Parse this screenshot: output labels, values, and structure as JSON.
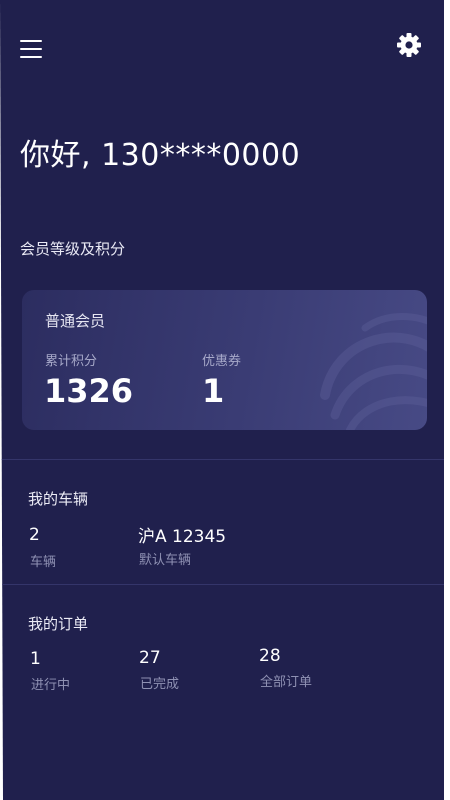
{
  "header": {
    "menu_icon": "hamburger-menu-icon",
    "settings_icon": "gear-icon"
  },
  "greeting": "你好, 130****0000",
  "membership": {
    "section_title": "会员等级及积分",
    "level": "普通会员",
    "points_label": "累计积分",
    "points_value": "1326",
    "coupons_label": "优惠券",
    "coupons_value": "1"
  },
  "vehicles": {
    "title": "我的车辆",
    "count_value": "2",
    "count_label": "车辆",
    "default_plate": "沪A 12345",
    "default_label": "默认车辆"
  },
  "orders": {
    "title": "我的订单",
    "in_progress_value": "1",
    "in_progress_label": "进行中",
    "completed_value": "27",
    "completed_label": "已完成",
    "all_value": "28",
    "all_label": "全部订单"
  },
  "colors": {
    "background": "#20204d",
    "card_start": "#2c2d60",
    "card_end": "#474a85",
    "muted_text": "#8f91b3"
  }
}
